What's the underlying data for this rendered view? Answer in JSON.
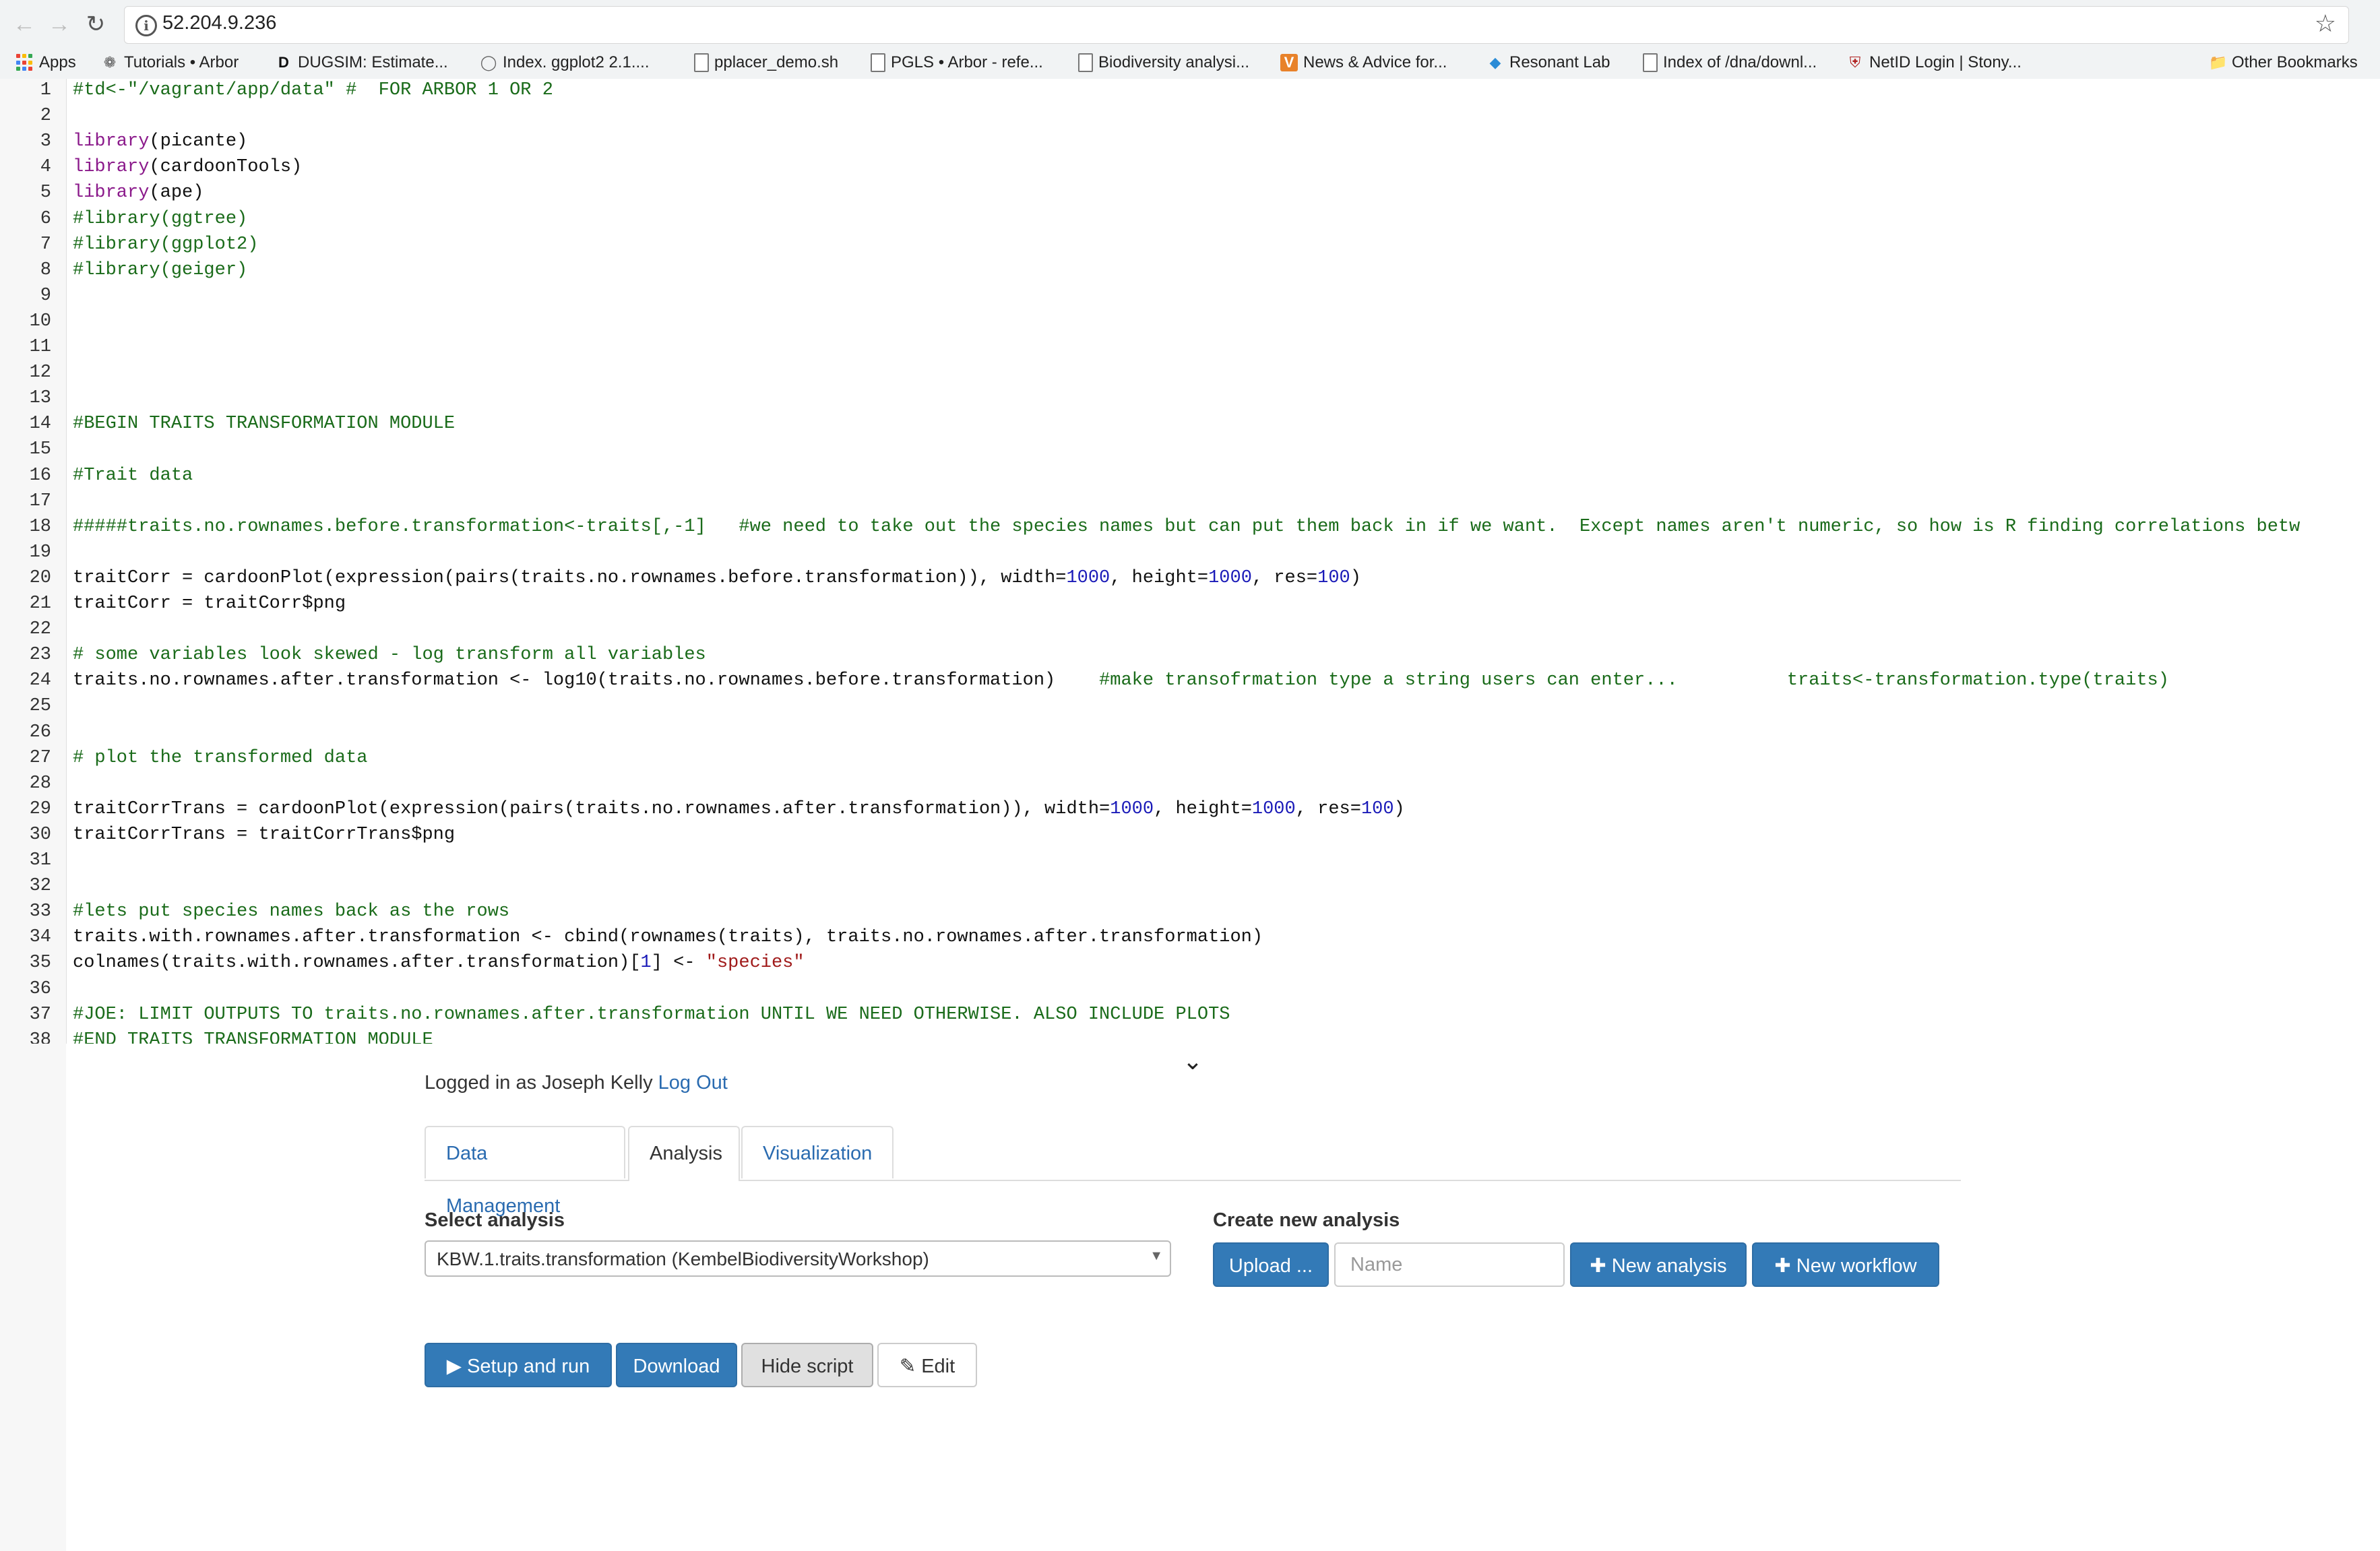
{
  "browser": {
    "url": "52.204.9.236",
    "bookmarks": [
      {
        "label": "Apps"
      },
      {
        "label": "Tutorials • Arbor"
      },
      {
        "label": "DUGSIM: Estimate..."
      },
      {
        "label": "Index. ggplot2 2.1...."
      },
      {
        "label": "pplacer_demo.sh"
      },
      {
        "label": "PGLS • Arbor - refe..."
      },
      {
        "label": "Biodiversity analysi..."
      },
      {
        "label": "News & Advice for..."
      },
      {
        "label": "Resonant Lab"
      },
      {
        "label": "Index of /dna/downl..."
      },
      {
        "label": "NetID Login | Stony..."
      },
      {
        "label": "Other Bookmarks"
      }
    ]
  },
  "editor": {
    "line_numbers": [
      "1",
      "2",
      "3",
      "4",
      "5",
      "6",
      "7",
      "8",
      "9",
      "10",
      "11",
      "12",
      "13",
      "14",
      "15",
      "16",
      "17",
      "18",
      "19",
      "20",
      "21",
      "22",
      "23",
      "24",
      "25",
      "26",
      "27",
      "28",
      "29",
      "30",
      "31",
      "32",
      "33",
      "34",
      "35",
      "36",
      "37",
      "38"
    ],
    "lines": [
      [
        {
          "t": "#td<-\"/vagrant/app/data\" #  FOR ARBOR 1 OR 2",
          "c": "cm"
        }
      ],
      [],
      [
        {
          "t": "library",
          "c": "kw"
        },
        {
          "t": "(picante)",
          "c": ""
        }
      ],
      [
        {
          "t": "library",
          "c": "kw"
        },
        {
          "t": "(cardoonTools)",
          "c": ""
        }
      ],
      [
        {
          "t": "library",
          "c": "kw"
        },
        {
          "t": "(ape)",
          "c": ""
        }
      ],
      [
        {
          "t": "#library(ggtree)",
          "c": "cm"
        }
      ],
      [
        {
          "t": "#library(ggplot2)",
          "c": "cm"
        }
      ],
      [
        {
          "t": "#library(geiger)",
          "c": "cm"
        }
      ],
      [],
      [],
      [],
      [],
      [],
      [
        {
          "t": "#BEGIN TRAITS TRANSFORMATION MODULE",
          "c": "cm"
        }
      ],
      [],
      [
        {
          "t": "#Trait data",
          "c": "cm"
        }
      ],
      [],
      [
        {
          "t": "#####traits.no.rownames.before.transformation<-traits[,-1]   #we need to take out the species names but can put them back in if we want.  Except names aren't numeric, so how is R finding correlations betw",
          "c": "cm"
        }
      ],
      [],
      [
        {
          "t": "traitCorr = cardoonPlot(expression(pairs(traits.no.rownames.before.transformation)), width=",
          "c": ""
        },
        {
          "t": "1000",
          "c": "nu"
        },
        {
          "t": ", height=",
          "c": ""
        },
        {
          "t": "1000",
          "c": "nu"
        },
        {
          "t": ", res=",
          "c": ""
        },
        {
          "t": "100",
          "c": "nu"
        },
        {
          "t": ")",
          "c": ""
        }
      ],
      [
        {
          "t": "traitCorr = traitCorr$png",
          "c": ""
        }
      ],
      [],
      [
        {
          "t": "# some variables look skewed - log transform all variables",
          "c": "cm"
        }
      ],
      [
        {
          "t": "traits.no.rownames.after.transformation <- log10(traits.no.rownames.before.transformation)    ",
          "c": ""
        },
        {
          "t": "#make transofrmation type a string users can enter...          traits<-transformation.type(traits)",
          "c": "cm"
        }
      ],
      [],
      [],
      [
        {
          "t": "# plot the transformed data",
          "c": "cm"
        }
      ],
      [],
      [
        {
          "t": "traitCorrTrans = cardoonPlot(expression(pairs(traits.no.rownames.after.transformation)), width=",
          "c": ""
        },
        {
          "t": "1000",
          "c": "nu"
        },
        {
          "t": ", height=",
          "c": ""
        },
        {
          "t": "1000",
          "c": "nu"
        },
        {
          "t": ", res=",
          "c": ""
        },
        {
          "t": "100",
          "c": "nu"
        },
        {
          "t": ")",
          "c": ""
        }
      ],
      [
        {
          "t": "traitCorrTrans = traitCorrTrans$png",
          "c": ""
        }
      ],
      [],
      [],
      [
        {
          "t": "#lets put species names back as the rows",
          "c": "cm"
        }
      ],
      [
        {
          "t": "traits.with.rownames.after.transformation <- cbind(rownames(traits), traits.no.rownames.after.transformation)",
          "c": ""
        }
      ],
      [
        {
          "t": "colnames(traits.with.rownames.after.transformation)[",
          "c": ""
        },
        {
          "t": "1",
          "c": "nu"
        },
        {
          "t": "] <- ",
          "c": ""
        },
        {
          "t": "\"species\"",
          "c": "st"
        }
      ],
      [],
      [
        {
          "t": "#JOE: LIMIT OUTPUTS TO traits.no.rownames.after.transformation UNTIL WE NEED OTHERWISE. ALSO INCLUDE PLOTS",
          "c": "cm"
        }
      ],
      [
        {
          "t": "#END TRAITS TRANSFORMATION MODULE",
          "c": "cm"
        }
      ]
    ]
  },
  "panel": {
    "login_prefix": "Logged in as Joseph Kelly",
    "logout_label": "Log Out",
    "tabs": [
      {
        "label": "Data Management"
      },
      {
        "label": "Analysis"
      },
      {
        "label": "Visualization"
      }
    ],
    "select_label": "Select analysis",
    "selected_analysis": "KBW.1.traits.transformation (KembelBiodiversityWorkshop)",
    "create_label": "Create new analysis",
    "upload_label": "Upload ...",
    "name_placeholder": "Name",
    "new_analysis_label": "New analysis",
    "new_workflow_label": "New workflow",
    "setup_run_label": "Setup and run",
    "download_label": "Download",
    "hide_script_label": "Hide script",
    "edit_label": "Edit"
  },
  "colors": {
    "primary": "#337ab7",
    "link": "#2a6bb0",
    "comment": "#1a6b1a",
    "keyword": "#8b1a8b",
    "number": "#1a1ab8",
    "string": "#a01a1a"
  },
  "icons": [
    "back-icon",
    "forward-icon",
    "reload-icon",
    "info-icon",
    "star-icon",
    "apps-icon",
    "page-icon",
    "folder-icon",
    "chevron-down-icon",
    "plus-icon",
    "play-icon",
    "edit-icon"
  ]
}
